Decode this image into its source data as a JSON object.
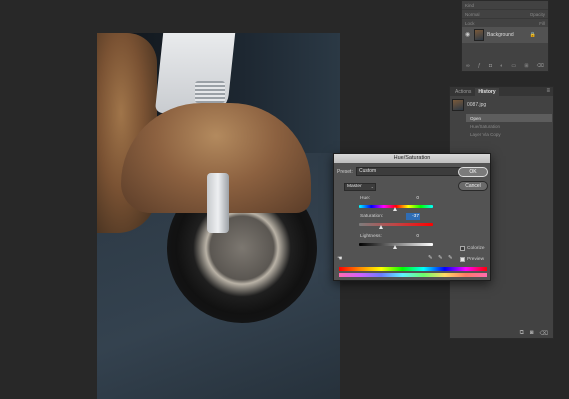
{
  "layers_panel": {
    "row1": [
      "Kind"
    ],
    "row2": [
      "Normal",
      "Opacity"
    ],
    "row3": [
      "Lock",
      "Fill"
    ],
    "layer_name": "Background"
  },
  "history_panel": {
    "tabs": [
      "Actions",
      "History"
    ],
    "snapshot_name": "0087.jpg",
    "steps": [
      "Open",
      "Hue/Saturation",
      "Layer Via Copy"
    ],
    "selected_step": "Open"
  },
  "dialog": {
    "title": "Hue/Saturation",
    "preset_label": "Preset:",
    "preset_value": "Custom",
    "range_value": "Master",
    "hue": {
      "label": "Hue:",
      "value": "0"
    },
    "saturation": {
      "label": "Saturation:",
      "value": "-37"
    },
    "lightness": {
      "label": "Lightness:",
      "value": "0"
    },
    "ok_label": "OK",
    "cancel_label": "Cancel",
    "colorize_label": "Colorize",
    "colorize_checked": false,
    "preview_label": "Preview",
    "preview_checked": true,
    "accent_color": "#2f6db5"
  },
  "icons": [
    "eye-icon",
    "lock-icon",
    "gear-icon",
    "hand-icon",
    "eyedropper-icon",
    "panel-menu-icon",
    "trash-icon",
    "camera-icon",
    "new-snapshot-icon"
  ]
}
